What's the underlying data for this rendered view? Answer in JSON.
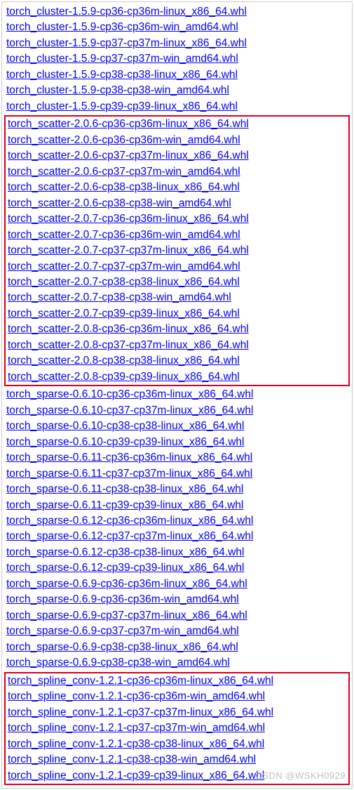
{
  "links_pre": [
    "torch_cluster-1.5.9-cp36-cp36m-linux_x86_64.whl",
    "torch_cluster-1.5.9-cp36-cp36m-win_amd64.whl",
    "torch_cluster-1.5.9-cp37-cp37m-linux_x86_64.whl",
    "torch_cluster-1.5.9-cp37-cp37m-win_amd64.whl",
    "torch_cluster-1.5.9-cp38-cp38-linux_x86_64.whl",
    "torch_cluster-1.5.9-cp38-cp38-win_amd64.whl",
    "torch_cluster-1.5.9-cp39-cp39-linux_x86_64.whl"
  ],
  "links_box1": [
    "torch_scatter-2.0.6-cp36-cp36m-linux_x86_64.whl",
    "torch_scatter-2.0.6-cp36-cp36m-win_amd64.whl",
    "torch_scatter-2.0.6-cp37-cp37m-linux_x86_64.whl",
    "torch_scatter-2.0.6-cp37-cp37m-win_amd64.whl",
    "torch_scatter-2.0.6-cp38-cp38-linux_x86_64.whl",
    "torch_scatter-2.0.6-cp38-cp38-win_amd64.whl",
    "torch_scatter-2.0.7-cp36-cp36m-linux_x86_64.whl",
    "torch_scatter-2.0.7-cp36-cp36m-win_amd64.whl",
    "torch_scatter-2.0.7-cp37-cp37m-linux_x86_64.whl",
    "torch_scatter-2.0.7-cp37-cp37m-win_amd64.whl",
    "torch_scatter-2.0.7-cp38-cp38-linux_x86_64.whl",
    "torch_scatter-2.0.7-cp38-cp38-win_amd64.whl",
    "torch_scatter-2.0.7-cp39-cp39-linux_x86_64.whl",
    "torch_scatter-2.0.8-cp36-cp36m-linux_x86_64.whl",
    "torch_scatter-2.0.8-cp37-cp37m-linux_x86_64.whl",
    "torch_scatter-2.0.8-cp38-cp38-linux_x86_64.whl",
    "torch_scatter-2.0.8-cp39-cp39-linux_x86_64.whl"
  ],
  "links_mid": [
    "torch_sparse-0.6.10-cp36-cp36m-linux_x86_64.whl",
    "torch_sparse-0.6.10-cp37-cp37m-linux_x86_64.whl",
    "torch_sparse-0.6.10-cp38-cp38-linux_x86_64.whl",
    "torch_sparse-0.6.10-cp39-cp39-linux_x86_64.whl",
    "torch_sparse-0.6.11-cp36-cp36m-linux_x86_64.whl",
    "torch_sparse-0.6.11-cp37-cp37m-linux_x86_64.whl",
    "torch_sparse-0.6.11-cp38-cp38-linux_x86_64.whl",
    "torch_sparse-0.6.11-cp39-cp39-linux_x86_64.whl",
    "torch_sparse-0.6.12-cp36-cp36m-linux_x86_64.whl",
    "torch_sparse-0.6.12-cp37-cp37m-linux_x86_64.whl",
    "torch_sparse-0.6.12-cp38-cp38-linux_x86_64.whl",
    "torch_sparse-0.6.12-cp39-cp39-linux_x86_64.whl",
    "torch_sparse-0.6.9-cp36-cp36m-linux_x86_64.whl",
    "torch_sparse-0.6.9-cp36-cp36m-win_amd64.whl",
    "torch_sparse-0.6.9-cp37-cp37m-linux_x86_64.whl",
    "torch_sparse-0.6.9-cp37-cp37m-win_amd64.whl",
    "torch_sparse-0.6.9-cp38-cp38-linux_x86_64.whl",
    "torch_sparse-0.6.9-cp38-cp38-win_amd64.whl"
  ],
  "links_box2": [
    "torch_spline_conv-1.2.1-cp36-cp36m-linux_x86_64.whl",
    "torch_spline_conv-1.2.1-cp36-cp36m-win_amd64.whl",
    "torch_spline_conv-1.2.1-cp37-cp37m-linux_x86_64.whl",
    "torch_spline_conv-1.2.1-cp37-cp37m-win_amd64.whl",
    "torch_spline_conv-1.2.1-cp38-cp38-linux_x86_64.whl",
    "torch_spline_conv-1.2.1-cp38-cp38-win_amd64.whl",
    "torch_spline_conv-1.2.1-cp39-cp39-linux_x86_64.whl"
  ],
  "watermark": "CSDN @WSKH0929"
}
